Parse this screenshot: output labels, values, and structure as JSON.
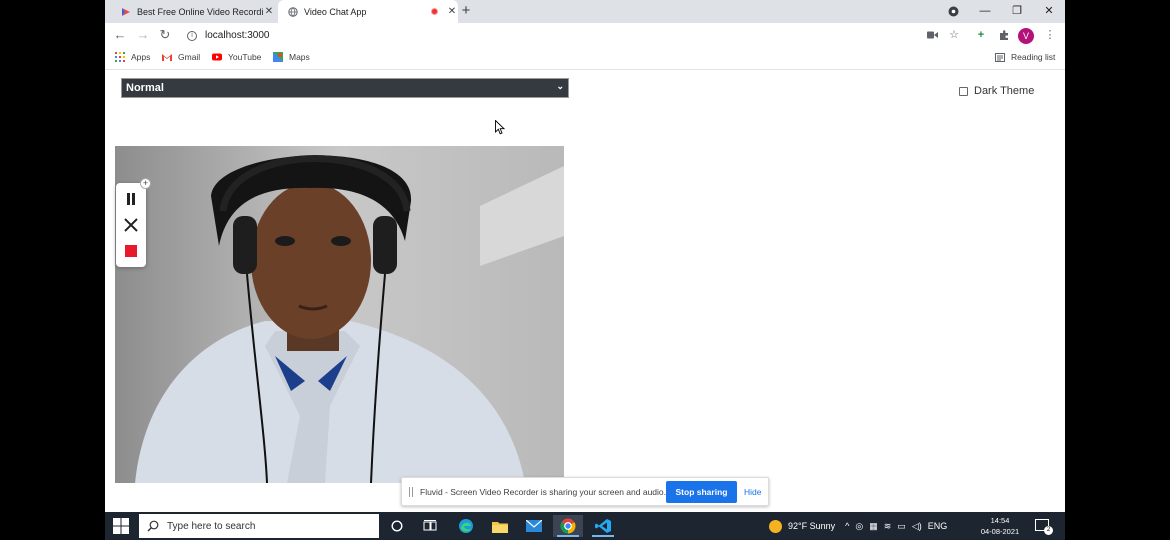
{
  "browser": {
    "tabs": [
      {
        "title": "Best Free Online Video Recording",
        "active": false
      },
      {
        "title": "Video Chat App",
        "active": true,
        "recording": true
      }
    ],
    "url": "localhost:3000",
    "avatar_initial": "V",
    "bookmarks": [
      "Apps",
      "Gmail",
      "YouTube",
      "Maps"
    ],
    "reading_list_label": "Reading list"
  },
  "page": {
    "mode_select": {
      "selected": "Normal"
    },
    "dark_theme": {
      "label": "Dark Theme",
      "checked": false
    }
  },
  "screen_share": {
    "message": "Fluvid - Screen Video Recorder is sharing your screen and audio.",
    "stop_label": "Stop sharing",
    "hide_label": "Hide"
  },
  "taskbar": {
    "search_placeholder": "Type here to search",
    "weather": "92°F  Sunny",
    "lang": "ENG",
    "time": "14:54",
    "date": "04-08-2021",
    "notifications": "2"
  },
  "colors": {
    "tab_strip": "#dee1e6",
    "select_bg": "#343a40",
    "accent": "#1a73e8",
    "taskbar": "#1c2530"
  }
}
